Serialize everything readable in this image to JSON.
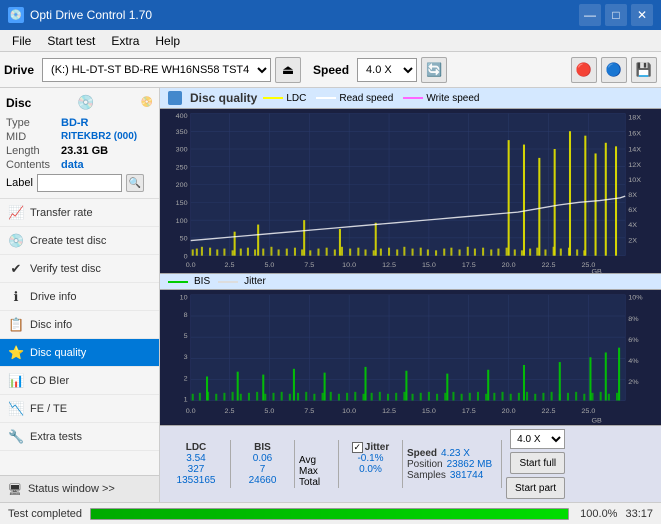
{
  "app": {
    "title": "Opti Drive Control 1.70",
    "icon": "💿"
  },
  "titlebar": {
    "minimize": "—",
    "maximize": "□",
    "close": "✕"
  },
  "menu": {
    "items": [
      "File",
      "Start test",
      "Extra",
      "Help"
    ]
  },
  "toolbar": {
    "drive_label": "Drive",
    "drive_value": "(K:)  HL-DT-ST BD-RE  WH16NS58 TST4",
    "speed_label": "Speed",
    "speed_value": "4.0 X"
  },
  "disc": {
    "title": "Disc",
    "type_label": "Type",
    "type_value": "BD-R",
    "mid_label": "MID",
    "mid_value": "RITEKBR2 (000)",
    "length_label": "Length",
    "length_value": "23.31 GB",
    "contents_label": "Contents",
    "contents_value": "data",
    "label_label": "Label"
  },
  "nav": {
    "items": [
      {
        "id": "transfer-rate",
        "label": "Transfer rate",
        "icon": "📈"
      },
      {
        "id": "create-test-disc",
        "label": "Create test disc",
        "icon": "💿"
      },
      {
        "id": "verify-test-disc",
        "label": "Verify test disc",
        "icon": "✔"
      },
      {
        "id": "drive-info",
        "label": "Drive info",
        "icon": "ℹ"
      },
      {
        "id": "disc-info",
        "label": "Disc info",
        "icon": "📋"
      },
      {
        "id": "disc-quality",
        "label": "Disc quality",
        "icon": "⭐",
        "active": true
      },
      {
        "id": "cd-bler",
        "label": "CD BIer",
        "icon": "📊"
      },
      {
        "id": "fe-te",
        "label": "FE / TE",
        "icon": "📉"
      },
      {
        "id": "extra-tests",
        "label": "Extra tests",
        "icon": "🔧"
      }
    ]
  },
  "status_window": {
    "label": "Status window >>",
    "icon": "🖥"
  },
  "chart1": {
    "title": "Disc quality",
    "legend": [
      {
        "label": "LDC",
        "color": "#ffff00"
      },
      {
        "label": "Read speed",
        "color": "#ffffff"
      },
      {
        "label": "Write speed",
        "color": "#ff66ff"
      }
    ],
    "y_max": 400,
    "y_axis_right": [
      "18X",
      "16X",
      "14X",
      "12X",
      "10X",
      "8X",
      "6X",
      "4X",
      "2X"
    ],
    "x_axis": [
      "0.0",
      "2.5",
      "5.0",
      "7.5",
      "10.0",
      "12.5",
      "15.0",
      "17.5",
      "20.0",
      "22.5",
      "25.0"
    ],
    "x_unit": "GB"
  },
  "chart2": {
    "legend": [
      {
        "label": "BIS",
        "color": "#00ff00"
      },
      {
        "label": "Jitter",
        "color": "#ffffff"
      }
    ],
    "y_max": 10,
    "y_axis_right": [
      "10%",
      "8%",
      "6%",
      "4%",
      "2%"
    ],
    "x_axis": [
      "0.0",
      "2.5",
      "5.0",
      "7.5",
      "10.0",
      "12.5",
      "15.0",
      "17.5",
      "20.0",
      "22.5",
      "25.0"
    ],
    "x_unit": "GB"
  },
  "stats": {
    "headers": [
      "LDC",
      "BIS",
      "",
      "Jitter",
      "Speed",
      ""
    ],
    "avg_label": "Avg",
    "avg_ldc": "3.54",
    "avg_bis": "0.06",
    "avg_jitter": "-0.1%",
    "avg_speed": "4.23 X",
    "max_label": "Max",
    "max_ldc": "327",
    "max_bis": "7",
    "max_jitter": "0.0%",
    "max_position_label": "Position",
    "max_position": "23862 MB",
    "total_label": "Total",
    "total_ldc": "1353165",
    "total_bis": "24660",
    "total_samples_label": "Samples",
    "total_samples": "381744",
    "speed_label": "Speed",
    "speed_value": "4.0 X",
    "start_full": "Start full",
    "start_part": "Start part",
    "jitter_checked": true,
    "jitter_label": "Jitter"
  },
  "statusbar": {
    "text": "Test completed",
    "progress": 100,
    "progress_text": "100.0%",
    "time": "33:17"
  }
}
